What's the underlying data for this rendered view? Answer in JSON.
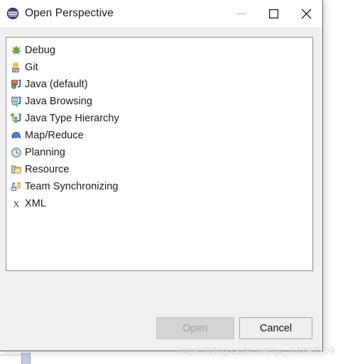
{
  "window": {
    "title": "Open Perspective",
    "icon": "eclipse-sphere-icon",
    "controls": {
      "minimize_label": "Minimize",
      "maximize_label": "Maximize",
      "close_label": "Close"
    }
  },
  "list": {
    "items": [
      {
        "label": "Debug",
        "icon": "bug-icon"
      },
      {
        "label": "Git",
        "icon": "git-repository-icon"
      },
      {
        "label": "Java (default)",
        "icon": "java-perspective-icon"
      },
      {
        "label": "Java Browsing",
        "icon": "java-browsing-icon"
      },
      {
        "label": "Java Type Hierarchy",
        "icon": "java-type-hierarchy-icon"
      },
      {
        "label": "Map/Reduce",
        "icon": "hadoop-elephant-icon"
      },
      {
        "label": "Planning",
        "icon": "clock-icon"
      },
      {
        "label": "Resource",
        "icon": "folder-icon"
      },
      {
        "label": "Team Synchronizing",
        "icon": "team-sync-icon"
      },
      {
        "label": "XML",
        "icon": "xml-icon"
      }
    ]
  },
  "buttons": {
    "open_label": "Open",
    "cancel_label": "Cancel"
  },
  "watermark": {
    "text": "https://blog.csdn.net/qq_44797209"
  },
  "colors": {
    "dialog_background": "#f0f0f0",
    "titlebar_background": "#ffffff",
    "list_background": "#ffffff",
    "list_border": "#8b8f94",
    "text": "#1b1b1b",
    "disabled_text": "#a0a0a0",
    "watermark": "#dadada"
  }
}
